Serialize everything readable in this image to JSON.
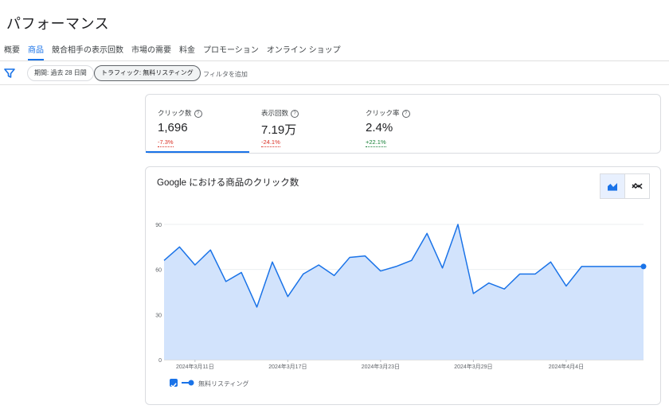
{
  "page_title": "パフォーマンス",
  "tabs": [
    {
      "label": "概要"
    },
    {
      "label": "商品"
    },
    {
      "label": "競合相手の表示回数"
    },
    {
      "label": "市場の需要"
    },
    {
      "label": "料金"
    },
    {
      "label": "プロモーション"
    },
    {
      "label": "オンライン ショップ"
    }
  ],
  "active_tab": "商品",
  "filters": {
    "period_chip": "期間: 過去 28 日間",
    "traffic_chip": "トラフィック: 無料リスティング",
    "add_filter": "フィルタを追加"
  },
  "metrics": [
    {
      "label": "クリック数",
      "value": "1,696",
      "change": "-7.3%",
      "trend": "negative",
      "selected": true
    },
    {
      "label": "表示回数",
      "value": "7.19万",
      "change": "-24.1%",
      "trend": "negative",
      "selected": false
    },
    {
      "label": "クリック率",
      "value": "2.4%",
      "change": "+22.1%",
      "trend": "positive",
      "selected": false
    }
  ],
  "help_icon_glyph": "?",
  "colors": {
    "accent": "#1a73e8",
    "area_fill": "#d2e3fc",
    "negative": "#d93025",
    "positive": "#188038"
  },
  "chart_data": {
    "type": "area",
    "title": "Google における商品のクリック数",
    "x": [
      "2024-03-09",
      "2024-03-10",
      "2024-03-11",
      "2024-03-12",
      "2024-03-13",
      "2024-03-14",
      "2024-03-15",
      "2024-03-16",
      "2024-03-17",
      "2024-03-18",
      "2024-03-19",
      "2024-03-20",
      "2024-03-21",
      "2024-03-22",
      "2024-03-23",
      "2024-03-24",
      "2024-03-25",
      "2024-03-26",
      "2024-03-27",
      "2024-03-28",
      "2024-03-29",
      "2024-03-30",
      "2024-03-31",
      "2024-04-01",
      "2024-04-02",
      "2024-04-03",
      "2024-04-04",
      "2024-04-05",
      "2024-04-06",
      "2024-04-07",
      "2024-04-08",
      "2024-04-09"
    ],
    "x_tick_labels": [
      {
        "index": 2,
        "label": "2024年3月11日"
      },
      {
        "index": 8,
        "label": "2024年3月17日"
      },
      {
        "index": 14,
        "label": "2024年3月23日"
      },
      {
        "index": 20,
        "label": "2024年3月29日"
      },
      {
        "index": 26,
        "label": "2024年4月4日"
      }
    ],
    "series": [
      {
        "name": "無料リスティング",
        "values": [
          66,
          75,
          63,
          73,
          52,
          58,
          35,
          65,
          42,
          57,
          63,
          56,
          68,
          69,
          59,
          62,
          66,
          84,
          61,
          90,
          44,
          51,
          47,
          57,
          57,
          65,
          49,
          62,
          62,
          62,
          62,
          62
        ]
      }
    ],
    "ylim": [
      0,
      90
    ],
    "yticks": [
      0,
      30,
      60,
      90
    ],
    "grid": true,
    "legend_position": "bottom-left"
  },
  "chart_toggles": [
    {
      "name": "area-chart-icon",
      "active": true
    },
    {
      "name": "compare-trend-icon",
      "active": false
    }
  ]
}
